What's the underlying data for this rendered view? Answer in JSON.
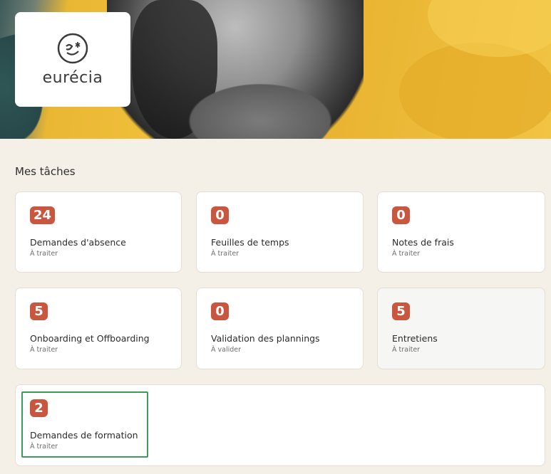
{
  "brand": {
    "name": "eurécia"
  },
  "section": {
    "title": "Mes tâches"
  },
  "tasks": [
    {
      "count": "24",
      "title": "Demandes d'absence",
      "status": "À traiter"
    },
    {
      "count": "0",
      "title": "Feuilles de temps",
      "status": "À traiter"
    },
    {
      "count": "0",
      "title": "Notes de frais",
      "status": "À traiter"
    },
    {
      "count": "5",
      "title": "Onboarding et Offboarding",
      "status": "À traiter"
    },
    {
      "count": "0",
      "title": "Validation des plannings",
      "status": "À valider"
    },
    {
      "count": "5",
      "title": "Entretiens",
      "status": "À traiter"
    },
    {
      "count": "2",
      "title": "Demandes de formation",
      "status": "À traiter"
    }
  ],
  "colors": {
    "badge": "#c9573f",
    "background": "#f4efe7",
    "focus": "#3a9b5a",
    "hero": "#f0bf3a"
  }
}
